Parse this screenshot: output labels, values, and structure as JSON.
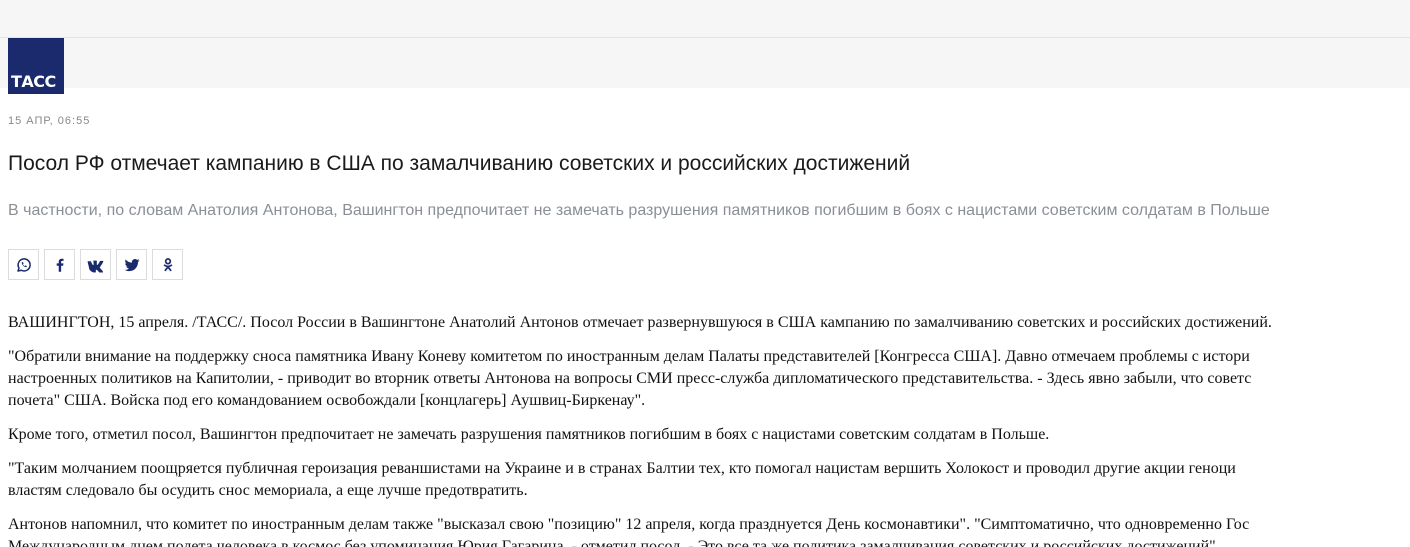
{
  "logo": {
    "text": "ТАСС"
  },
  "article": {
    "date": "15 АПР, 06:55",
    "headline": "Посол РФ отмечает кампанию в США по замалчиванию советских и российских достижений",
    "lead": "В частности, по словам Анатолия Антонова, Вашингтон предпочитает не замечать разрушения памятников погибшим в боях с нацистами советским солдатам в Польше",
    "paragraphs": [
      [
        "ВАШИНГТОН, 15 апреля. /ТАСС/. Посол России в Вашингтоне Анатолий Антонов отмечает развернувшуюся в США кампанию по замалчиванию советских и российских достижений."
      ],
      [
        "\"Обратили внимание на поддержку сноса памятника Ивану Коневу комитетом по иностранным делам Палаты представителей [Конгресса США]. Давно отмечаем проблемы с истори",
        "настроенных политиков на Капитолии, - приводит во вторник ответы Антонова на вопросы СМИ пресс-служба дипломатического представительства. - Здесь явно забыли, что советс",
        "почета\" США. Войска под его командованием освобождали [концлагерь] Аушвиц-Биркенау\"."
      ],
      [
        "Кроме того, отметил посол, Вашингтон предпочитает не замечать разрушения памятников погибшим в боях с нацистами советским солдатам в Польше."
      ],
      [
        "\"Таким молчанием поощряется публичная героизация реваншистами на Украине и в странах Балтии тех, кто помогал нацистам вершить Холокост и проводил другие акции геноци",
        "властям следовало бы осудить снос мемориала, а еще лучше предотвратить."
      ],
      [
        "Антонов напомнил, что комитет по иностранным делам также \"высказал свою \"позицию\" 12 апреля, когда празднуется День космонавтики\". \"Симптоматично, что одновременно Гос",
        "Международным днем полета человека в космос без упоминания Юрия Гагарина, - отметил посол. - Это все та же политика замалчивания советских и российских достижений\"."
      ]
    ]
  },
  "share": [
    {
      "name": "whatsapp-share-button",
      "icon": "whatsapp-icon"
    },
    {
      "name": "facebook-share-button",
      "icon": "facebook-icon"
    },
    {
      "name": "vk-share-button",
      "icon": "vk-icon"
    },
    {
      "name": "twitter-share-button",
      "icon": "twitter-icon"
    },
    {
      "name": "odnoklassniki-share-button",
      "icon": "odnoklassniki-icon"
    }
  ],
  "colors": {
    "brand": "#1a2a6c",
    "icon": "#1a2a6c",
    "lead_text": "#8a8f96",
    "date_text": "#888888"
  }
}
